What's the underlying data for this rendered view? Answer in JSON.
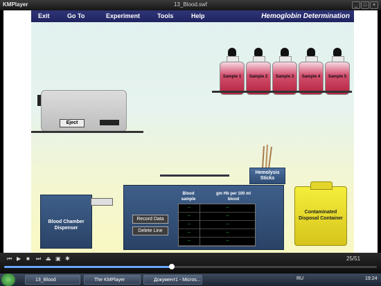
{
  "window": {
    "app_name": "KMPlayer",
    "file_name": "13_Blood.swf"
  },
  "window_buttons": [
    "_",
    "□",
    "×"
  ],
  "app": {
    "menu": [
      "Exit",
      "Go To",
      "Experiment",
      "Tools",
      "Help"
    ],
    "title": "Hemoglobin Determination"
  },
  "samples": [
    "Sample 1",
    "Sample 2",
    "Sample 3",
    "Sample 4",
    "Sample 5"
  ],
  "machine": {
    "eject_label": "Eject"
  },
  "dispenser": {
    "label": "Blood Chamber Dispenser"
  },
  "hemolysis": {
    "label": "Hemolysis Sticks"
  },
  "disposal": {
    "label": "Contaminated Disposal Container"
  },
  "console": {
    "record_label": "Record Data",
    "delete_label": "Delete Line",
    "col1_header": "Blood sample",
    "col2_header": "gm Hb per 100 ml blood",
    "rows": [
      [
        "--",
        "--"
      ],
      [
        "--",
        "--"
      ],
      [
        "--",
        "--"
      ],
      [
        "--",
        "--"
      ],
      [
        "--",
        "--"
      ]
    ]
  },
  "player": {
    "time_text": "25/51",
    "progress": 0.45,
    "playback_icons": [
      "previous-icon",
      "play-icon",
      "stop-icon",
      "next-icon",
      "eject-icon",
      "screen-icon",
      "settings-icon"
    ]
  },
  "taskbar": {
    "tasks": [
      "13_Blood",
      "The KMPlayer",
      "Документ1 - Micros..."
    ],
    "language": "RU",
    "clock": "19:24"
  }
}
